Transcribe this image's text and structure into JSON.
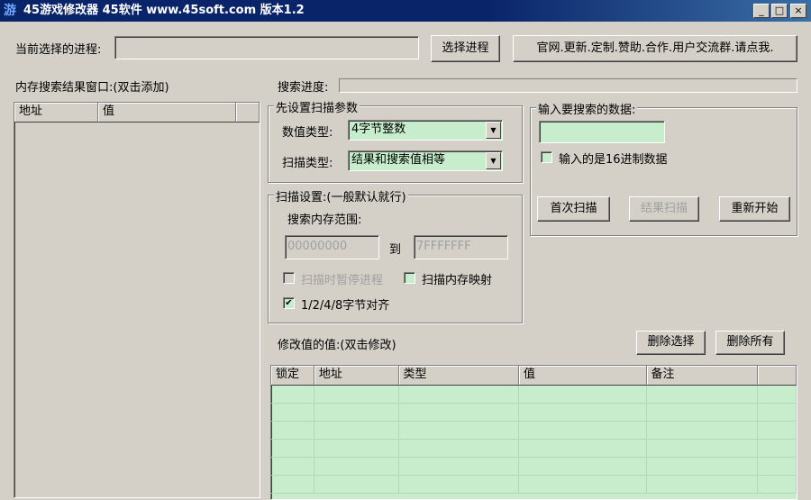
{
  "window": {
    "title": "45游戏修改器 45软件 www.45soft.com 版本1.2",
    "icon": "游",
    "buttons": [
      "_",
      "□",
      "×"
    ]
  },
  "process": {
    "label": "当前选择的进程:",
    "value": "",
    "select_button": "选择进程",
    "site_button": "官网.更新.定制.赞助.合作.用户交流群.请点我."
  },
  "results": {
    "label": "内存搜索结果窗口:(双击添加)",
    "columns": [
      "地址",
      "值"
    ]
  },
  "progress": {
    "label": "搜索进度:",
    "value": 0
  },
  "scan_params": {
    "title": "先设置扫描参数",
    "value_type_label": "数值类型:",
    "value_type": "4字节整数",
    "scan_type_label": "扫描类型:",
    "scan_type": "结果和搜索值相等"
  },
  "scan_settings": {
    "title": "扫描设置:(一般默认就行)",
    "range_label": "搜索内存范围:",
    "range_from": "00000000",
    "to_label": "到",
    "range_to": "7FFFFFFF",
    "pause_label": "扫描时暂停进程",
    "pause_checked": false,
    "mapped_label": "扫描内存映射",
    "mapped_checked": false,
    "align_label": "1/2/4/8字节对齐",
    "align_checked": true
  },
  "search_input": {
    "title": "输入要搜索的数据:",
    "value": "",
    "hex_label": "输入的是16进制数据",
    "hex_checked": false,
    "first_scan": "首次扫描",
    "next_scan": "结果扫描",
    "restart": "重新开始"
  },
  "modify": {
    "label": "修改值的值:(双击修改)",
    "delete_selected": "删除选择",
    "delete_all": "删除所有",
    "columns": [
      "锁定",
      "地址",
      "类型",
      "值",
      "备注",
      ""
    ]
  }
}
